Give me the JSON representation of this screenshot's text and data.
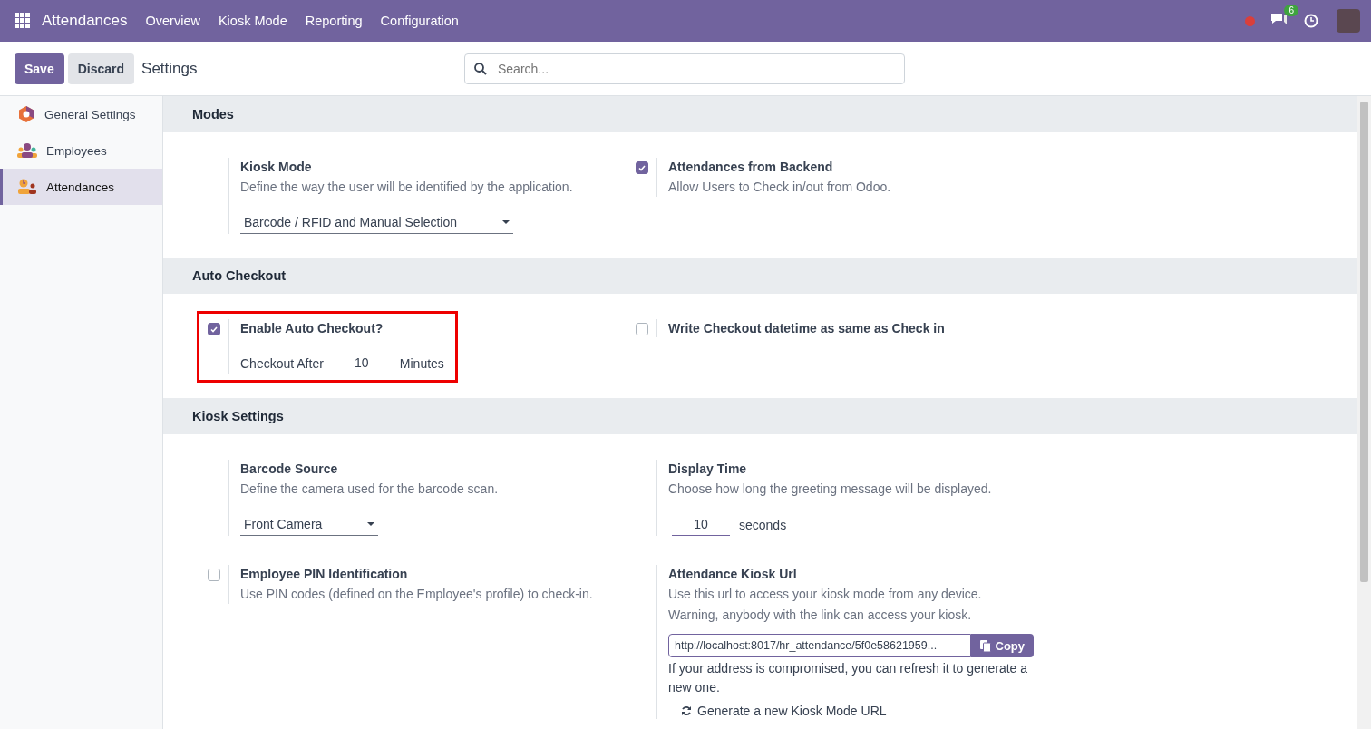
{
  "navbar": {
    "app_name": "Attendances",
    "menu": [
      "Overview",
      "Kiosk Mode",
      "Reporting",
      "Configuration"
    ],
    "chat_badge": "6"
  },
  "control_panel": {
    "buttons": [
      {
        "label": "Save",
        "kind": "primary"
      },
      {
        "label": "Discard",
        "kind": "secondary"
      }
    ],
    "title": "Settings",
    "search": {
      "placeholder": "Search..."
    }
  },
  "sidebar": {
    "items": [
      {
        "label": "General Settings",
        "kind": "general",
        "selected": false
      },
      {
        "label": "Employees",
        "kind": "employees",
        "selected": false
      },
      {
        "label": "Attendances",
        "kind": "attendances",
        "selected": true
      }
    ]
  },
  "sections": [
    {
      "title": "Modes",
      "settings": [
        {
          "title": "Kiosk Mode",
          "description": [
            "Define the way the user will be identified by the application."
          ],
          "select": "Barcode / RFID and Manual Selection"
        },
        {
          "checked": true,
          "title": "Attendances from Backend",
          "description": [
            "Allow Users to Check in/out from Odoo."
          ]
        }
      ]
    },
    {
      "title": "Auto Checkout",
      "settings": [
        {
          "checked": true,
          "highlighted": true,
          "title": "Enable Auto Checkout?",
          "inline_field": {
            "label": "Checkout After",
            "value": "10",
            "suffix": "Minutes"
          }
        },
        {
          "checked": false,
          "title": "Write Checkout datetime as same as Check in"
        }
      ]
    },
    {
      "title": "Kiosk Settings",
      "settings": [
        {
          "title": "Barcode Source",
          "description": [
            "Define the camera used for the barcode scan."
          ],
          "select": "Front Camera"
        },
        {
          "title": "Display Time",
          "description": [
            "Choose how long the greeting message will be displayed."
          ],
          "inline_field": {
            "value": "10",
            "suffix": "seconds"
          }
        },
        {
          "checked": false,
          "title": "Employee PIN Identification",
          "description": [
            "Use PIN codes (defined on the Employee's profile) to check-in."
          ]
        },
        {
          "title": "Attendance Kiosk Url",
          "description": [
            "Use this url to access your kiosk mode from any device.",
            "Warning, anybody with the link can access your kiosk."
          ],
          "url": {
            "value": "http://localhost:8017/hr_attendance/5f0e58621959...",
            "button": "Copy"
          },
          "note": "If your address is compromised, you can refresh it to generate a new one.",
          "link": "Generate a new Kiosk Mode URL"
        }
      ]
    }
  ]
}
